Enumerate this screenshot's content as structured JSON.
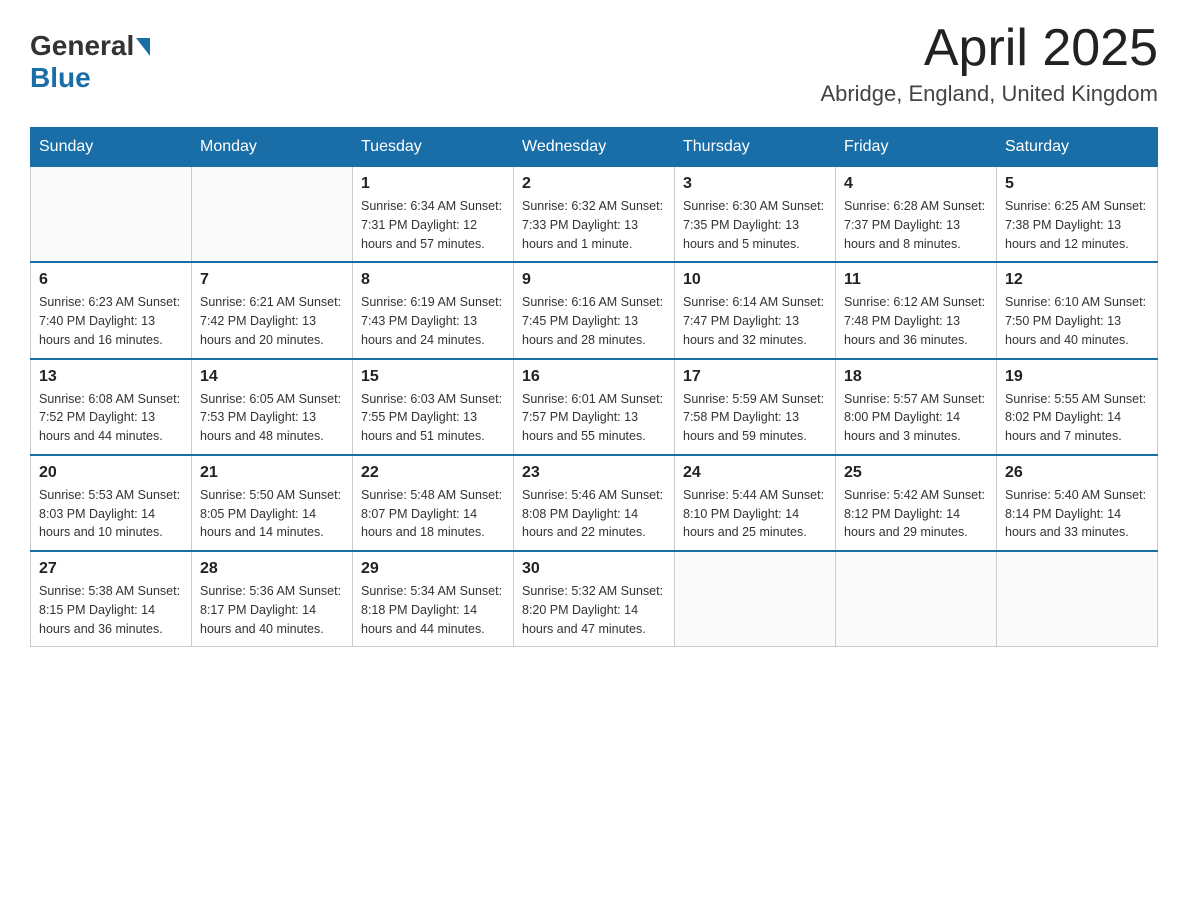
{
  "header": {
    "logo_general": "General",
    "logo_blue": "Blue",
    "title": "April 2025",
    "subtitle": "Abridge, England, United Kingdom"
  },
  "weekdays": [
    "Sunday",
    "Monday",
    "Tuesday",
    "Wednesday",
    "Thursday",
    "Friday",
    "Saturday"
  ],
  "weeks": [
    [
      {
        "day": "",
        "info": ""
      },
      {
        "day": "",
        "info": ""
      },
      {
        "day": "1",
        "info": "Sunrise: 6:34 AM\nSunset: 7:31 PM\nDaylight: 12 hours\nand 57 minutes."
      },
      {
        "day": "2",
        "info": "Sunrise: 6:32 AM\nSunset: 7:33 PM\nDaylight: 13 hours\nand 1 minute."
      },
      {
        "day": "3",
        "info": "Sunrise: 6:30 AM\nSunset: 7:35 PM\nDaylight: 13 hours\nand 5 minutes."
      },
      {
        "day": "4",
        "info": "Sunrise: 6:28 AM\nSunset: 7:37 PM\nDaylight: 13 hours\nand 8 minutes."
      },
      {
        "day": "5",
        "info": "Sunrise: 6:25 AM\nSunset: 7:38 PM\nDaylight: 13 hours\nand 12 minutes."
      }
    ],
    [
      {
        "day": "6",
        "info": "Sunrise: 6:23 AM\nSunset: 7:40 PM\nDaylight: 13 hours\nand 16 minutes."
      },
      {
        "day": "7",
        "info": "Sunrise: 6:21 AM\nSunset: 7:42 PM\nDaylight: 13 hours\nand 20 minutes."
      },
      {
        "day": "8",
        "info": "Sunrise: 6:19 AM\nSunset: 7:43 PM\nDaylight: 13 hours\nand 24 minutes."
      },
      {
        "day": "9",
        "info": "Sunrise: 6:16 AM\nSunset: 7:45 PM\nDaylight: 13 hours\nand 28 minutes."
      },
      {
        "day": "10",
        "info": "Sunrise: 6:14 AM\nSunset: 7:47 PM\nDaylight: 13 hours\nand 32 minutes."
      },
      {
        "day": "11",
        "info": "Sunrise: 6:12 AM\nSunset: 7:48 PM\nDaylight: 13 hours\nand 36 minutes."
      },
      {
        "day": "12",
        "info": "Sunrise: 6:10 AM\nSunset: 7:50 PM\nDaylight: 13 hours\nand 40 minutes."
      }
    ],
    [
      {
        "day": "13",
        "info": "Sunrise: 6:08 AM\nSunset: 7:52 PM\nDaylight: 13 hours\nand 44 minutes."
      },
      {
        "day": "14",
        "info": "Sunrise: 6:05 AM\nSunset: 7:53 PM\nDaylight: 13 hours\nand 48 minutes."
      },
      {
        "day": "15",
        "info": "Sunrise: 6:03 AM\nSunset: 7:55 PM\nDaylight: 13 hours\nand 51 minutes."
      },
      {
        "day": "16",
        "info": "Sunrise: 6:01 AM\nSunset: 7:57 PM\nDaylight: 13 hours\nand 55 minutes."
      },
      {
        "day": "17",
        "info": "Sunrise: 5:59 AM\nSunset: 7:58 PM\nDaylight: 13 hours\nand 59 minutes."
      },
      {
        "day": "18",
        "info": "Sunrise: 5:57 AM\nSunset: 8:00 PM\nDaylight: 14 hours\nand 3 minutes."
      },
      {
        "day": "19",
        "info": "Sunrise: 5:55 AM\nSunset: 8:02 PM\nDaylight: 14 hours\nand 7 minutes."
      }
    ],
    [
      {
        "day": "20",
        "info": "Sunrise: 5:53 AM\nSunset: 8:03 PM\nDaylight: 14 hours\nand 10 minutes."
      },
      {
        "day": "21",
        "info": "Sunrise: 5:50 AM\nSunset: 8:05 PM\nDaylight: 14 hours\nand 14 minutes."
      },
      {
        "day": "22",
        "info": "Sunrise: 5:48 AM\nSunset: 8:07 PM\nDaylight: 14 hours\nand 18 minutes."
      },
      {
        "day": "23",
        "info": "Sunrise: 5:46 AM\nSunset: 8:08 PM\nDaylight: 14 hours\nand 22 minutes."
      },
      {
        "day": "24",
        "info": "Sunrise: 5:44 AM\nSunset: 8:10 PM\nDaylight: 14 hours\nand 25 minutes."
      },
      {
        "day": "25",
        "info": "Sunrise: 5:42 AM\nSunset: 8:12 PM\nDaylight: 14 hours\nand 29 minutes."
      },
      {
        "day": "26",
        "info": "Sunrise: 5:40 AM\nSunset: 8:14 PM\nDaylight: 14 hours\nand 33 minutes."
      }
    ],
    [
      {
        "day": "27",
        "info": "Sunrise: 5:38 AM\nSunset: 8:15 PM\nDaylight: 14 hours\nand 36 minutes."
      },
      {
        "day": "28",
        "info": "Sunrise: 5:36 AM\nSunset: 8:17 PM\nDaylight: 14 hours\nand 40 minutes."
      },
      {
        "day": "29",
        "info": "Sunrise: 5:34 AM\nSunset: 8:18 PM\nDaylight: 14 hours\nand 44 minutes."
      },
      {
        "day": "30",
        "info": "Sunrise: 5:32 AM\nSunset: 8:20 PM\nDaylight: 14 hours\nand 47 minutes."
      },
      {
        "day": "",
        "info": ""
      },
      {
        "day": "",
        "info": ""
      },
      {
        "day": "",
        "info": ""
      }
    ]
  ]
}
